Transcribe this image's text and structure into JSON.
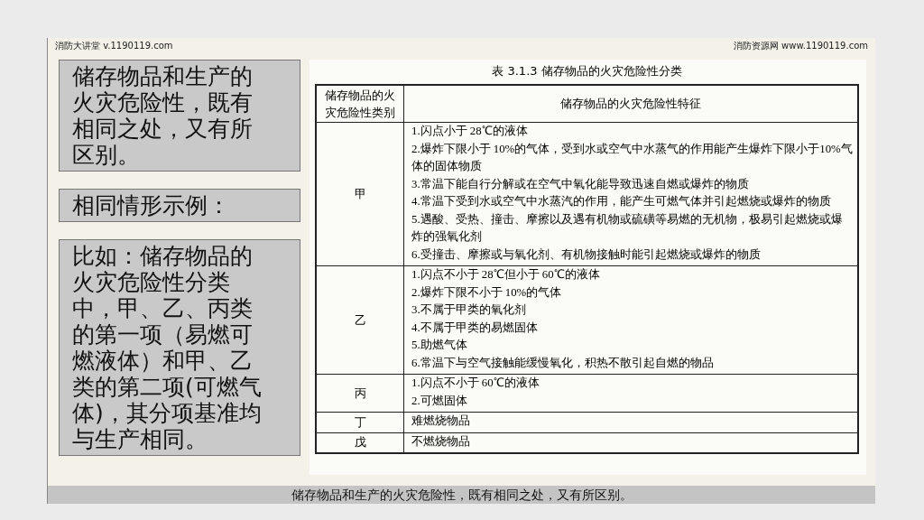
{
  "header": {
    "left": "消防大讲堂 v.1190119.com",
    "right": "消防资源网 www.1190119.com"
  },
  "notes": [
    "储存物品和生产的火灾危险性，既有相同之处，又有所区别。",
    "相同情形示例：",
    "比如：储存物品的火灾危险性分类中，甲、乙、丙类的第一项（易燃可燃液体）和甲、乙类的第二项(可燃气体)，其分项基准均与生产相同。"
  ],
  "table": {
    "title": "表 3.1.3 储存物品的火灾危险性分类",
    "columns": [
      "储存物品的火灾危险性类别",
      "储存物品的火灾危险性特征"
    ],
    "rows": [
      {
        "category": "甲",
        "items": [
          "1.闪点小于 28℃的液体",
          "2.爆炸下限小于  10%的气体，受到水或空气中水蒸气的作用能产生爆炸下限小于10%气体的固体物质",
          "3.常温下能自行分解或在空气中氧化能导致迅速自燃或爆炸的物质",
          "4.常温下受到水或空气中水蒸汽的作用，能产生可燃气体并引起燃烧或爆炸的物质",
          "5.遇酸、受热、撞击、摩擦以及遇有机物或硫磺等易燃的无机物，极易引起燃烧或爆炸的强氧化剂",
          "6.受撞击、摩擦或与氧化剂、有机物接触时能引起燃烧或爆炸的物质"
        ]
      },
      {
        "category": "乙",
        "items": [
          "1.闪点不小于 28℃但小于 60℃的液体",
          "2.爆炸下限不小于 10%的气体",
          "3.不属于甲类的氧化剂",
          "4.不属于甲类的易燃固体",
          "5.助燃气体",
          "6.常温下与空气接触能缓慢氧化，积热不散引起自燃的物品"
        ]
      },
      {
        "category": "丙",
        "items": [
          "1.闪点不小于 60℃的液体",
          "2.可燃固体"
        ]
      },
      {
        "category": "丁",
        "items": [
          "难燃烧物品"
        ]
      },
      {
        "category": "戊",
        "items": [
          "不燃烧物品"
        ]
      }
    ]
  },
  "caption": "储存物品和生产的火灾危险性，既有相同之处，又有所区别。"
}
